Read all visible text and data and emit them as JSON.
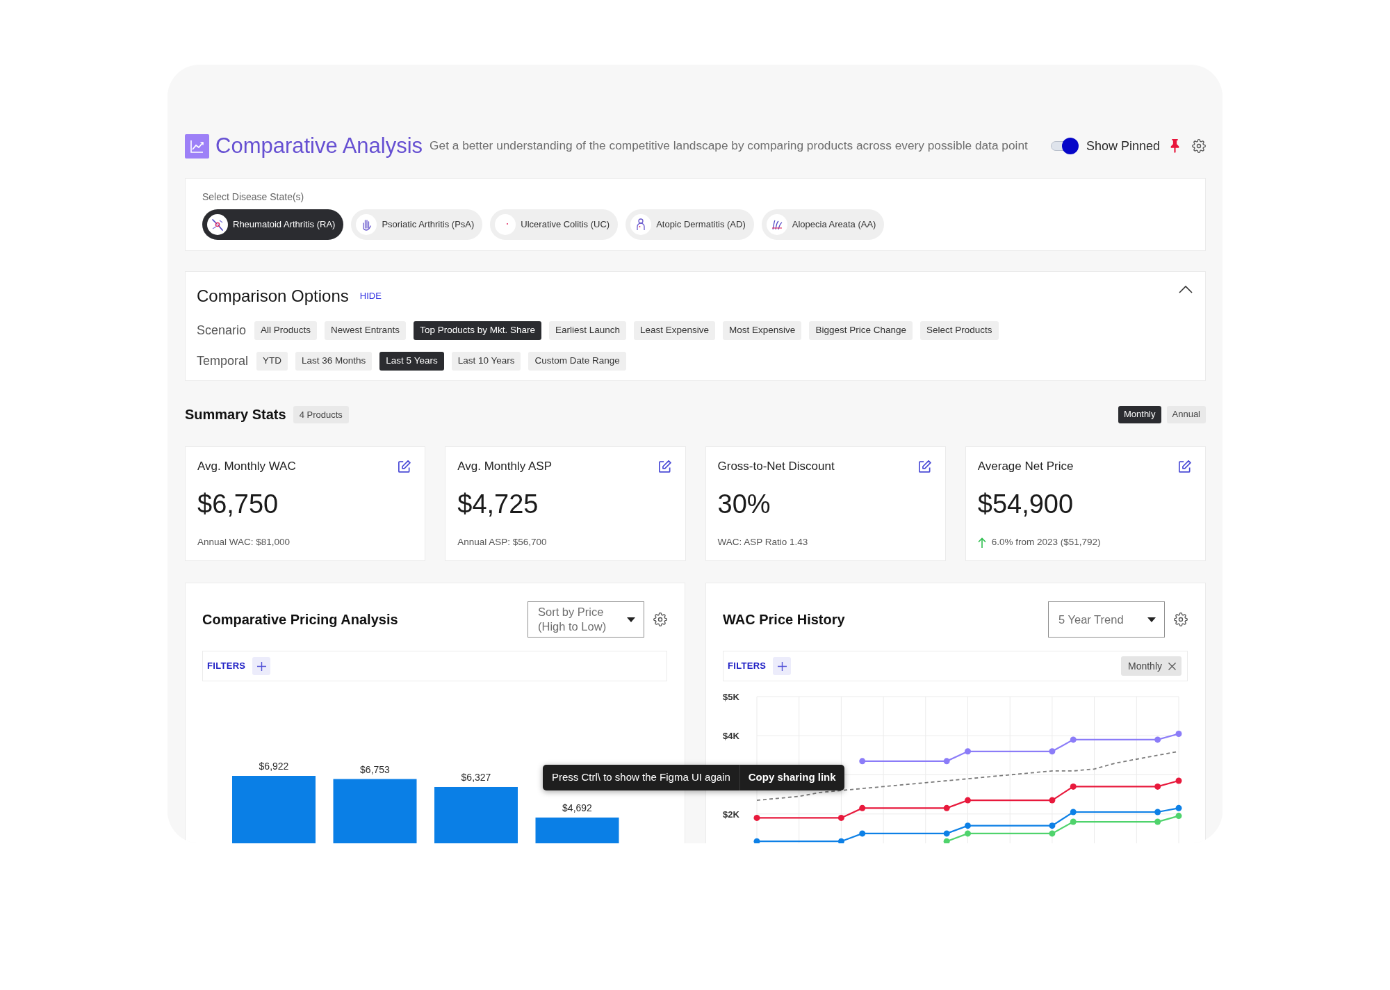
{
  "header": {
    "title": "Comparative Analysis",
    "subtitle": "Get a better understanding of the competitive landscape by comparing products across every possible data point",
    "show_pinned": {
      "label": "Show Pinned",
      "on": true
    }
  },
  "disease_states": {
    "label": "Select Disease State(s)",
    "items": [
      {
        "label": "Rheumatoid Arthritis (RA)",
        "selected": true
      },
      {
        "label": "Psoriatic Arthritis (PsA)",
        "selected": false
      },
      {
        "label": "Ulcerative Colitis (UC)",
        "selected": false
      },
      {
        "label": "Atopic Dermatitis (AD)",
        "selected": false
      },
      {
        "label": "Alopecia Areata (AA)",
        "selected": false
      }
    ]
  },
  "comparison_options": {
    "title": "Comparison Options",
    "hide_link": "HIDE",
    "expanded": true,
    "rows": [
      {
        "label": "Scenario",
        "options": [
          {
            "label": "All Products",
            "selected": false
          },
          {
            "label": "Newest Entrants",
            "selected": false
          },
          {
            "label": "Top Products by Mkt. Share",
            "selected": true
          },
          {
            "label": "Earliest Launch",
            "selected": false
          },
          {
            "label": "Least Expensive",
            "selected": false
          },
          {
            "label": "Most Expensive",
            "selected": false
          },
          {
            "label": "Biggest Price Change",
            "selected": false
          },
          {
            "label": "Select Products",
            "selected": false
          }
        ]
      },
      {
        "label": "Temporal",
        "options": [
          {
            "label": "YTD",
            "selected": false
          },
          {
            "label": "Last 36 Months",
            "selected": false
          },
          {
            "label": "Last 5 Years",
            "selected": true
          },
          {
            "label": "Last 10 Years",
            "selected": false
          },
          {
            "label": "Custom Date Range",
            "selected": false
          }
        ]
      }
    ]
  },
  "summary_stats": {
    "title": "Summary Stats",
    "badge": "4 Products",
    "periods": [
      {
        "label": "Monthly",
        "selected": true
      },
      {
        "label": "Annual",
        "selected": false
      }
    ],
    "cards": [
      {
        "title": "Avg. Monthly WAC",
        "value": "$6,750",
        "note": "Annual WAC: $81,000"
      },
      {
        "title": "Avg. Monthly ASP",
        "value": "$4,725",
        "note": "Annual ASP: $56,700"
      },
      {
        "title": "Gross-to-Net Discount",
        "value": "30%",
        "note": "WAC: ASP Ratio 1.43"
      },
      {
        "title": "Average Net Price",
        "value": "$54,900",
        "note": "6.0% from 2023 ($51,792)",
        "rising": true
      }
    ]
  },
  "charts": [
    {
      "title": "Comparative Pricing Analysis",
      "select": "Sort by Price (High to Low)",
      "filters_label": "FILTERS",
      "bar_labels": [
        "$6,922",
        "$6,753",
        "$6,327",
        "$4,692"
      ]
    },
    {
      "title": "WAC Price History",
      "select": "5 Year Trend",
      "filters_label": "FILTERS",
      "filter_chips": [
        {
          "label": "Monthly"
        }
      ],
      "chart_data": {
        "type": "line",
        "grid": true,
        "categories": [
          null,
          null,
          null,
          null,
          null,
          null,
          null,
          null,
          null,
          null,
          null,
          null,
          null,
          null,
          null,
          null,
          null,
          null,
          null,
          null,
          null
        ],
        "ylim": [
          1250,
          5000
        ],
        "yticks": [
          {
            "value": 2000,
            "label": "$2K"
          },
          {
            "value": 4000,
            "label": "$4K"
          },
          {
            "value": 5000,
            "label": "$5K"
          }
        ],
        "series": [
          {
            "color": "#8b7cf8",
            "values": [
              null,
              null,
              null,
              null,
              null,
              3350,
              3350,
              3350,
              3350,
              3350,
              3600,
              3600,
              3600,
              3600,
              3600,
              3900,
              3900,
              3900,
              3900,
              3900,
              4050
            ]
          },
          {
            "color": "#7a7a7a",
            "line_style": "dashed",
            "values": [
              2350,
              2400,
              2450,
              2550,
              2600,
              2650,
              2700,
              2750,
              2800,
              2850,
              2900,
              2950,
              3000,
              3050,
              3100,
              3100,
              3150,
              3300,
              3400,
              3500,
              3600
            ]
          },
          {
            "color": "#e8193c",
            "values": [
              1900,
              1900,
              1900,
              1900,
              1900,
              2150,
              2150,
              2150,
              2150,
              2150,
              2350,
              2350,
              2350,
              2350,
              2350,
              2700,
              2700,
              2700,
              2700,
              2700,
              2850
            ]
          },
          {
            "color": "#0d80e6",
            "values": [
              1300,
              1300,
              1300,
              1300,
              1300,
              1500,
              1500,
              1500,
              1500,
              1500,
              1700,
              1700,
              1700,
              1700,
              1700,
              2050,
              2050,
              2050,
              2050,
              2050,
              2150
            ]
          },
          {
            "color": "#4fd36c",
            "values": [
              null,
              null,
              null,
              null,
              null,
              null,
              null,
              null,
              null,
              1300,
              1500,
              1500,
              1500,
              1500,
              1500,
              1800,
              1800,
              1800,
              1800,
              1800,
              1950
            ]
          }
        ]
      }
    }
  ],
  "toast": {
    "message": "Press Ctrl\\ to show the Figma UI again",
    "action": "Copy sharing link"
  }
}
